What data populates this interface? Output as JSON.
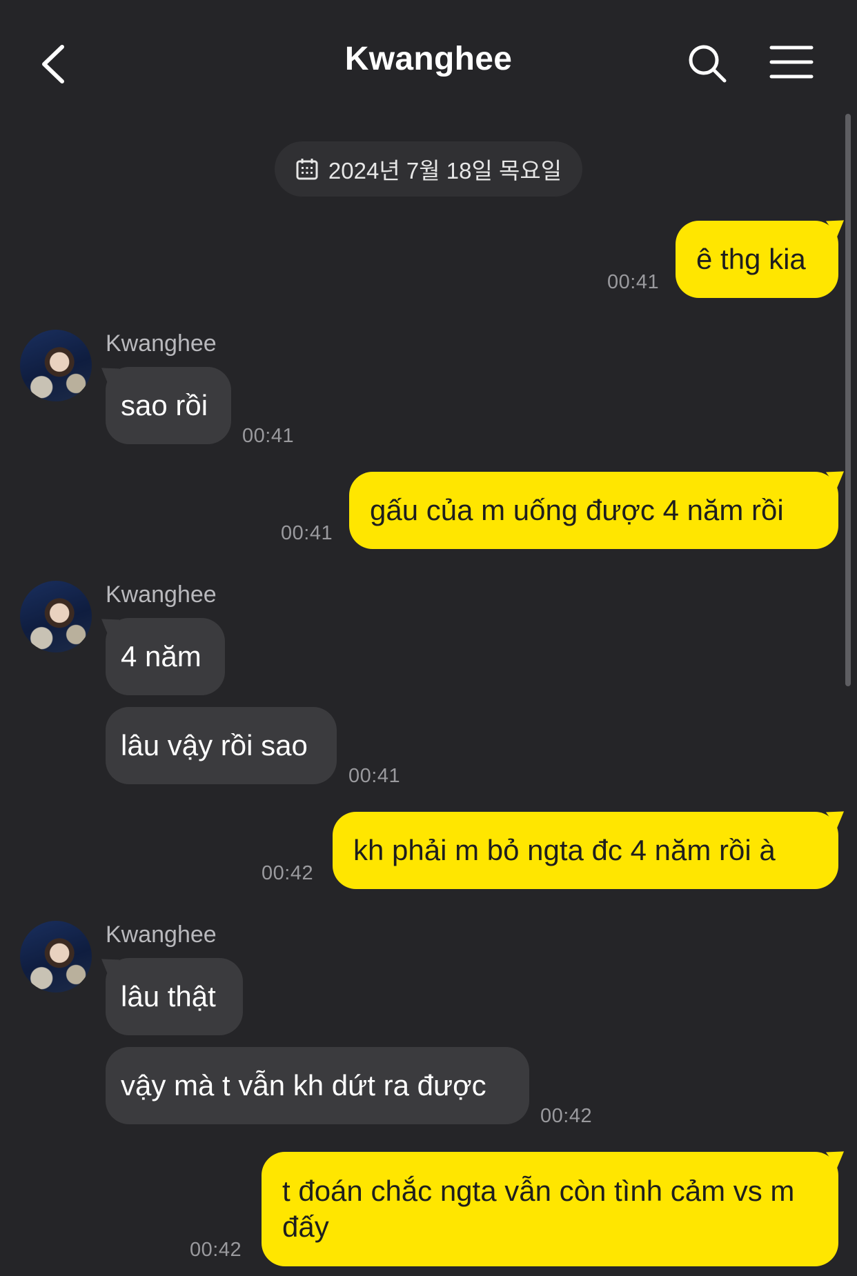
{
  "header": {
    "title": "Kwanghee",
    "back_icon": "chevron-left-icon",
    "search_icon": "search-icon",
    "menu_icon": "hamburger-menu-icon"
  },
  "date_divider": {
    "icon": "calendar-icon",
    "text": "2024년 7월 18일 목요일"
  },
  "contact": {
    "name": "Kwanghee"
  },
  "messages": [
    {
      "from": "me",
      "text": "ê thg kia",
      "time": "00:41"
    },
    {
      "from": "them",
      "sender": "Kwanghee",
      "text": "sao rồi",
      "time": "00:41"
    },
    {
      "from": "me",
      "text": "gấu của m uống được 4 năm rồi",
      "time": "00:41"
    },
    {
      "from": "them",
      "sender": "Kwanghee",
      "text": "4 năm",
      "time": ""
    },
    {
      "from": "them",
      "text": "lâu vậy rồi sao",
      "time": "00:41"
    },
    {
      "from": "me",
      "text": "kh phải m bỏ ngta đc 4 năm rồi à",
      "time": "00:42"
    },
    {
      "from": "them",
      "sender": "Kwanghee",
      "text": "lâu thật",
      "time": ""
    },
    {
      "from": "them",
      "text": "vậy mà t vẫn kh dứt ra được",
      "time": "00:42"
    },
    {
      "from": "me",
      "text": "t đoán chắc ngta vẫn còn tình cảm vs m đấy",
      "time": "00:42"
    }
  ],
  "colors": {
    "background": "#252528",
    "my_bubble": "#ffe600",
    "their_bubble": "#3b3b3e"
  }
}
